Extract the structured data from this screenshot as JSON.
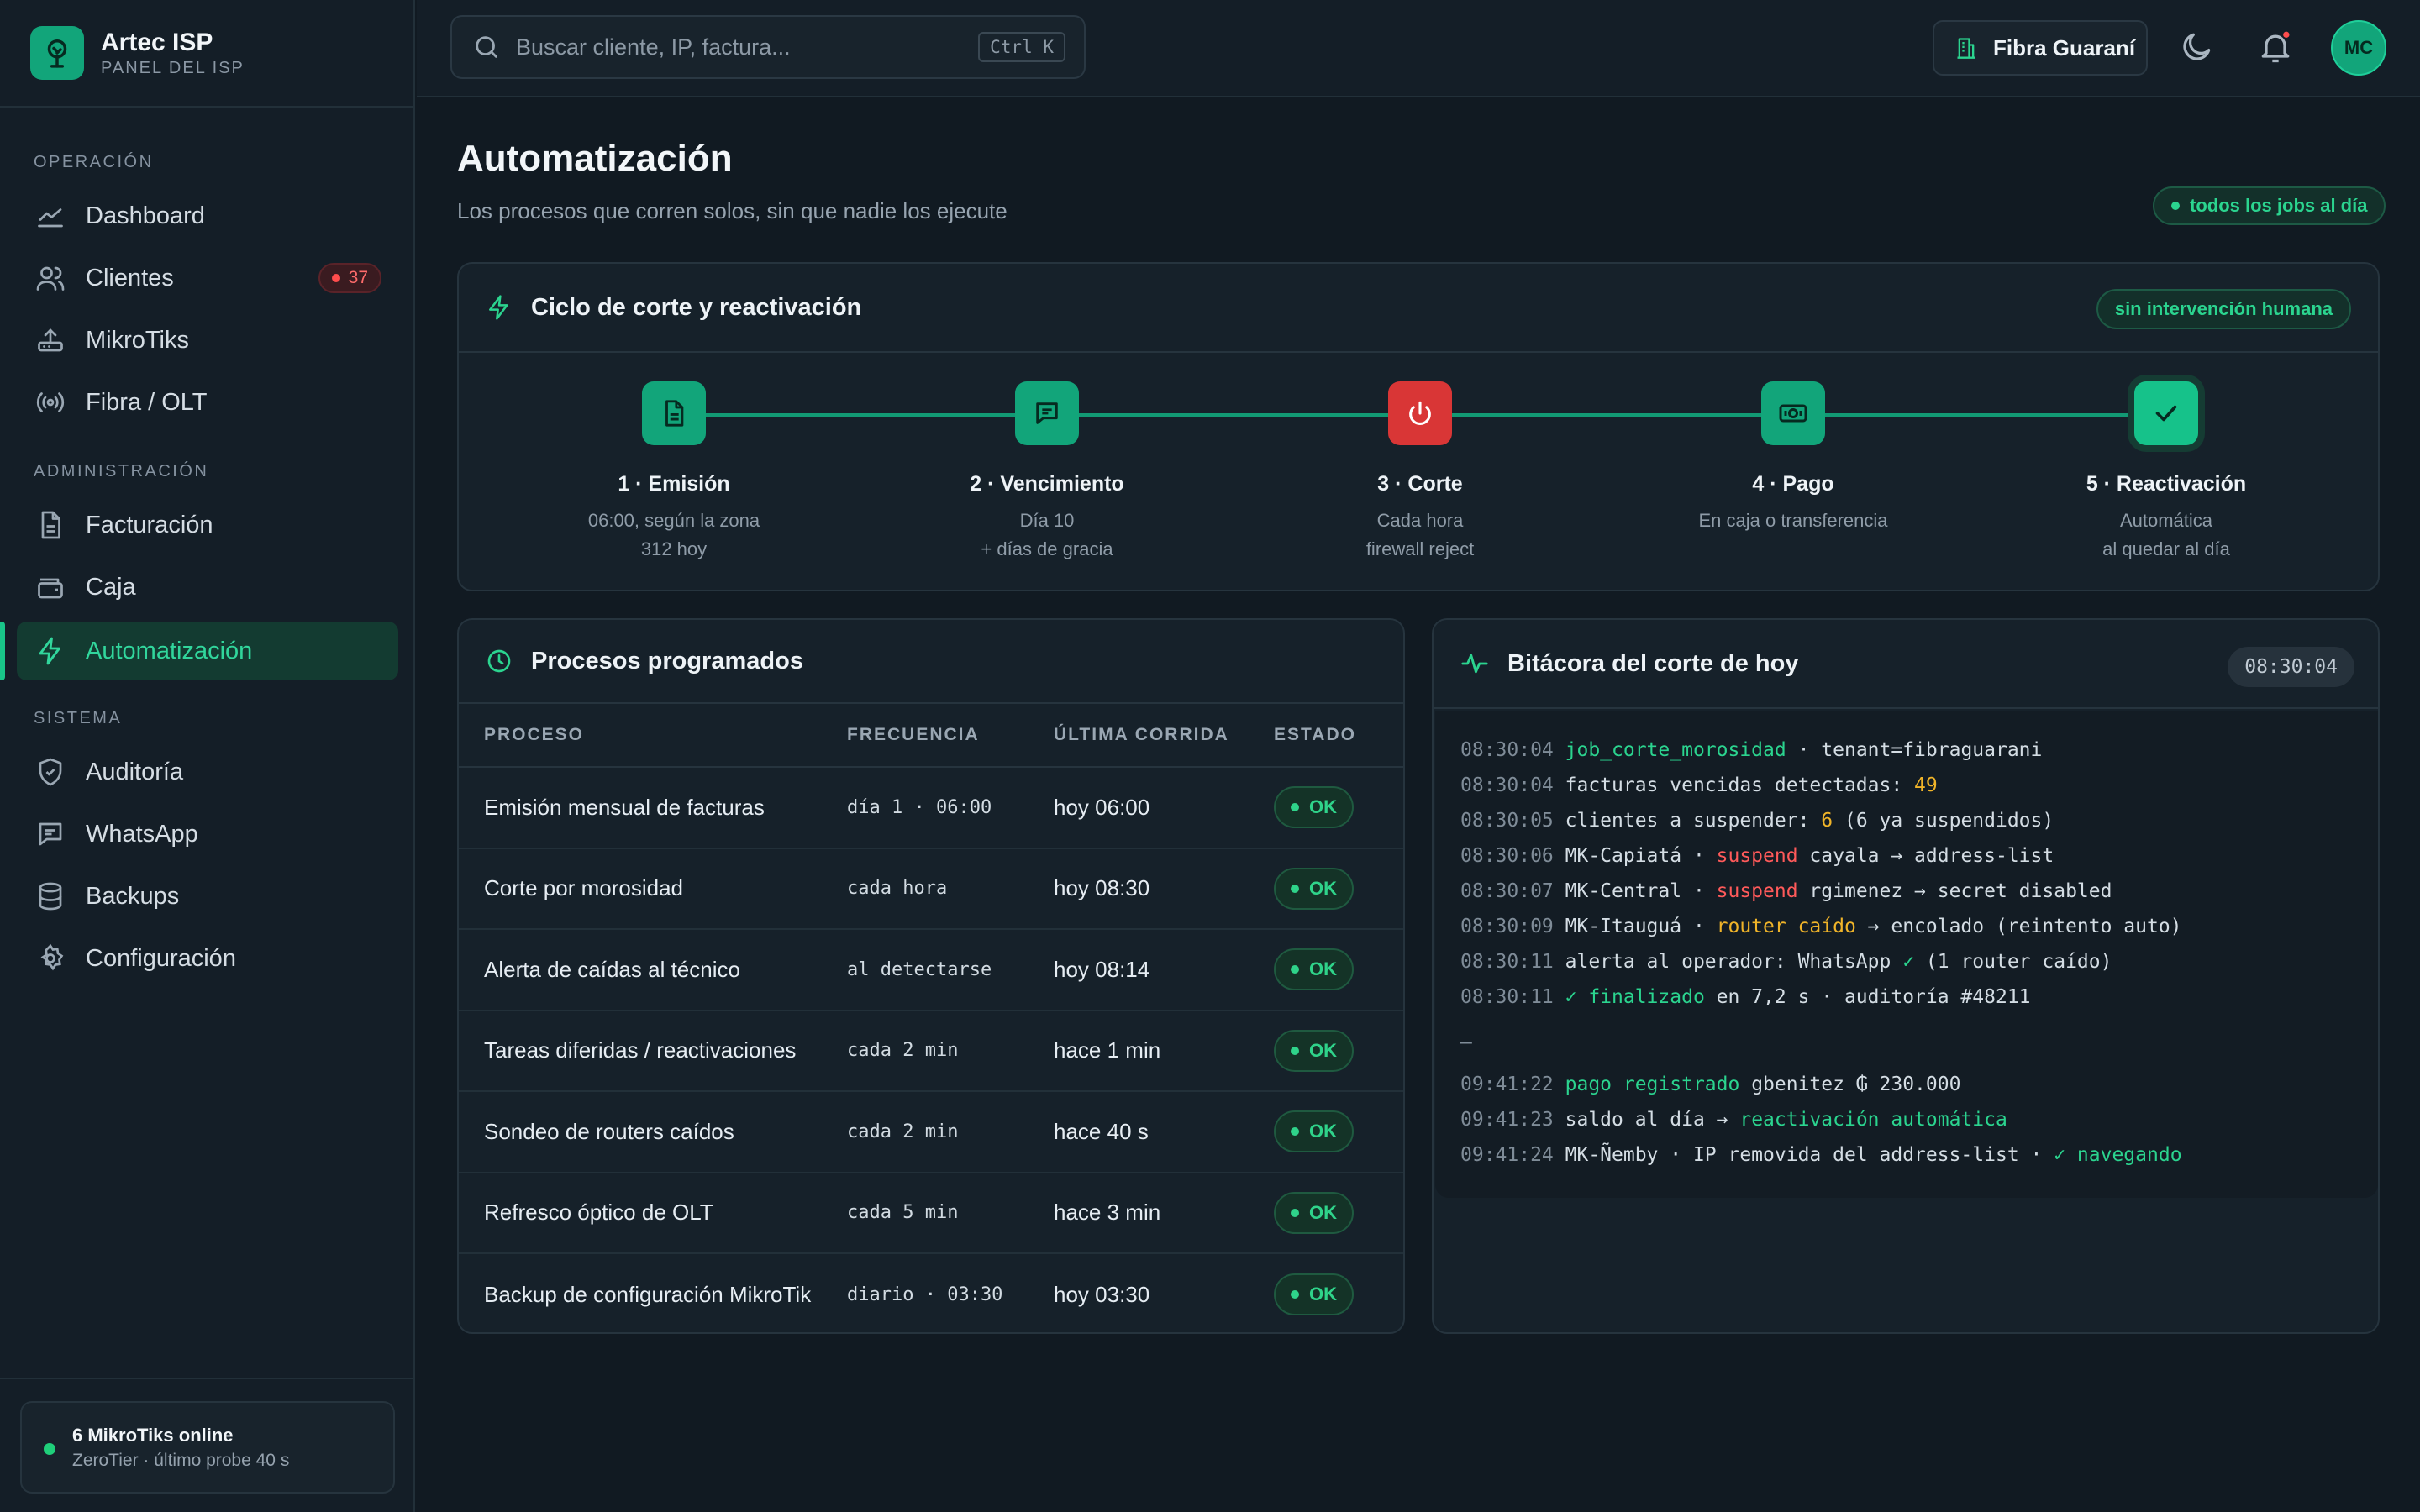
{
  "brand": {
    "name": "Artec ISP",
    "sub": "PANEL DEL ISP"
  },
  "nav": {
    "sections": {
      "operacion": "OPERACIÓN",
      "administracion": "ADMINISTRACIÓN",
      "sistema": "SISTEMA"
    },
    "items": [
      {
        "label": "Dashboard"
      },
      {
        "label": "Clientes",
        "badge": "37"
      },
      {
        "label": "MikroTiks"
      },
      {
        "label": "Fibra / OLT"
      },
      {
        "label": "Facturación"
      },
      {
        "label": "Caja"
      },
      {
        "label": "Automatización"
      },
      {
        "label": "Auditoría"
      },
      {
        "label": "WhatsApp"
      },
      {
        "label": "Backups"
      },
      {
        "label": "Configuración"
      }
    ]
  },
  "sidebar_status": {
    "title": "6 MikroTiks online",
    "sub": "ZeroTier · último probe 40 s"
  },
  "topbar": {
    "search_placeholder": "Buscar cliente, IP, factura...",
    "search_shortcut": "Ctrl K",
    "tenant": "Fibra Guaraní",
    "avatar": "MC"
  },
  "page": {
    "title": "Automatización",
    "subtitle": "Los procesos que corren solos, sin que nadie los ejecute",
    "status_pill": "todos los jobs al día"
  },
  "cycle": {
    "title": "Ciclo de corte y reactivación",
    "pill": "sin intervención humana",
    "steps": [
      {
        "title": "1 · Emisión",
        "line1": "06:00, según la zona",
        "line2": "312 hoy"
      },
      {
        "title": "2 · Vencimiento",
        "line1": "Día 10",
        "line2": "+ días de gracia"
      },
      {
        "title": "3 · Corte",
        "line1": "Cada hora",
        "line2": "firewall reject"
      },
      {
        "title": "4 · Pago",
        "line1": "En caja o transferencia",
        "line2": ""
      },
      {
        "title": "5 · Reactivación",
        "line1": "Automática",
        "line2": "al quedar al día"
      }
    ]
  },
  "processes": {
    "title": "Procesos programados",
    "columns": [
      "PROCESO",
      "FRECUENCIA",
      "ÚLTIMA CORRIDA",
      "ESTADO"
    ],
    "rows": [
      {
        "name": "Emisión mensual de facturas",
        "freq": "día 1 · 06:00",
        "last": "hoy 06:00",
        "status": "OK"
      },
      {
        "name": "Corte por morosidad",
        "freq": "cada hora",
        "last": "hoy 08:30",
        "status": "OK"
      },
      {
        "name": "Alerta de caídas al técnico",
        "freq": "al detectarse",
        "last": "hoy 08:14",
        "status": "OK"
      },
      {
        "name": "Tareas diferidas / reactivaciones",
        "freq": "cada 2 min",
        "last": "hace 1 min",
        "status": "OK"
      },
      {
        "name": "Sondeo de routers caídos",
        "freq": "cada 2 min",
        "last": "hace 40 s",
        "status": "OK"
      },
      {
        "name": "Refresco óptico de OLT",
        "freq": "cada 5 min",
        "last": "hace 3 min",
        "status": "OK"
      },
      {
        "name": "Backup de configuración MikroTik",
        "freq": "diario · 03:30",
        "last": "hoy 03:30",
        "status": "OK"
      }
    ]
  },
  "log": {
    "title": "Bitácora del corte de hoy",
    "time": "08:30:04",
    "lines": [
      {
        "t": "08:30:04",
        "parts": [
          [
            "g",
            "job_corte_morosidad"
          ],
          [
            "",
            " · tenant=fibraguarani"
          ]
        ]
      },
      {
        "t": "08:30:04",
        "parts": [
          [
            "",
            "facturas vencidas detectadas: "
          ],
          [
            "y",
            "49"
          ]
        ]
      },
      {
        "t": "08:30:05",
        "parts": [
          [
            "",
            "clientes a suspender: "
          ],
          [
            "y",
            "6"
          ],
          [
            "",
            " (6 ya suspendidos)"
          ]
        ]
      },
      {
        "t": "08:30:06",
        "parts": [
          [
            "",
            "MK-Capiatá · "
          ],
          [
            "r",
            "suspend"
          ],
          [
            "",
            " cayala → address-list"
          ]
        ]
      },
      {
        "t": "08:30:07",
        "parts": [
          [
            "",
            "MK-Central · "
          ],
          [
            "r",
            "suspend"
          ],
          [
            "",
            " rgimenez → secret disabled"
          ]
        ]
      },
      {
        "t": "08:30:09",
        "parts": [
          [
            "",
            "MK-Itauguá · "
          ],
          [
            "y",
            "router caído"
          ],
          [
            "",
            " → encolado (reintento auto)"
          ]
        ]
      },
      {
        "t": "08:30:11",
        "parts": [
          [
            "",
            "alerta al operador: WhatsApp "
          ],
          [
            "g",
            "✓"
          ],
          [
            "",
            " (1 router caído)"
          ]
        ]
      },
      {
        "t": "08:30:11",
        "parts": [
          [
            "g",
            "✓ finalizado"
          ],
          [
            "",
            " en 7,2 s · auditoría #48211"
          ]
        ]
      },
      {
        "sep": "—"
      },
      {
        "t": "09:41:22",
        "parts": [
          [
            "g",
            "pago registrado"
          ],
          [
            "",
            " gbenitez ₲ 230.000"
          ]
        ]
      },
      {
        "t": "09:41:23",
        "parts": [
          [
            "",
            "saldo al día → "
          ],
          [
            "g",
            "reactivación automática"
          ]
        ]
      },
      {
        "t": "09:41:24",
        "parts": [
          [
            "",
            "MK-Ñemby · IP removida del address-list · "
          ],
          [
            "g",
            "✓ navegando"
          ]
        ]
      }
    ]
  },
  "colors": {
    "accent": "#12a57a",
    "accent_bright": "#2bd48f",
    "danger": "#d93636",
    "warning": "#f0b429",
    "bg": "#111a22",
    "panel": "#16212a"
  },
  "icons": [
    "tree-logo-icon",
    "search-icon",
    "building-icon",
    "moon-icon",
    "bell-icon",
    "chart-line-icon",
    "users-icon",
    "router-icon",
    "broadcast-icon",
    "file-icon",
    "wallet-icon",
    "bolt-icon",
    "shield-icon",
    "chat-icon",
    "database-icon",
    "gear-icon",
    "clock-icon",
    "pulse-icon",
    "power-icon",
    "money-icon",
    "check-icon"
  ]
}
